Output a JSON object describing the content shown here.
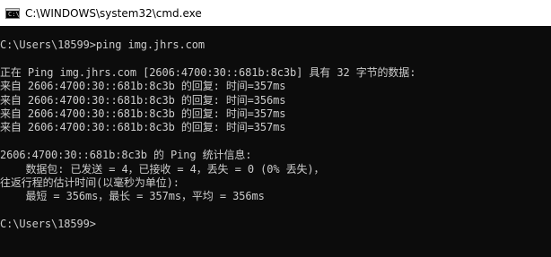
{
  "window": {
    "title": "C:\\WINDOWS\\system32\\cmd.exe",
    "icon": "cmd-console-icon"
  },
  "console": {
    "lines": [
      "C:\\Users\\18599>ping img.jhrs.com",
      "",
      "正在 Ping img.jhrs.com [2606:4700:30::681b:8c3b] 具有 32 字节的数据:",
      "来自 2606:4700:30::681b:8c3b 的回复: 时间=357ms",
      "来自 2606:4700:30::681b:8c3b 的回复: 时间=356ms",
      "来自 2606:4700:30::681b:8c3b 的回复: 时间=357ms",
      "来自 2606:4700:30::681b:8c3b 的回复: 时间=357ms",
      "",
      "2606:4700:30::681b:8c3b 的 Ping 统计信息:",
      "    数据包: 已发送 = 4，已接收 = 4，丢失 = 0 (0% 丢失)，",
      "往返行程的估计时间(以毫秒为单位):",
      "    最短 = 356ms，最长 = 357ms，平均 = 356ms",
      "",
      "C:\\Users\\18599>"
    ]
  },
  "colors": {
    "console_background": "#0c0c0c",
    "console_text": "#cccccc",
    "titlebar_background": "#ffffff"
  }
}
